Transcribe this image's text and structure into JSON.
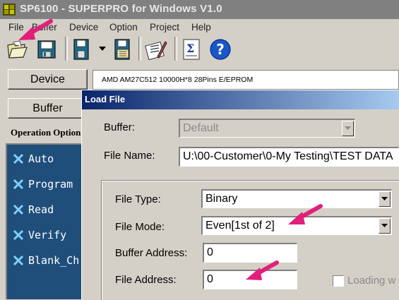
{
  "window": {
    "title": "SP6100 - SUPERPRO for Windows V1.0"
  },
  "menu": [
    "File",
    "Buffer",
    "Device",
    "Option",
    "Project",
    "Help"
  ],
  "toolbar": {
    "buttons": [
      "open-file-icon",
      "save-icon",
      "chip-load-icon",
      "chip-save-icon",
      "edit-tools-icon",
      "sum-icon",
      "help-icon"
    ]
  },
  "left": {
    "device_label": "Device",
    "buffer_label": "Buffer",
    "device_info": "AMD  AM27C512  10000H*8  28Pins  E/EPROM",
    "operation_option_label": "Operation Option",
    "operations": [
      "Auto",
      "Program",
      "Read",
      "Verify",
      "Blank_Ch"
    ]
  },
  "dialog": {
    "title": "Load File",
    "buffer_label": "Buffer:",
    "buffer_value": "Default",
    "file_name_label": "File Name:",
    "file_name_value": "U:\\00-Customer\\0-My Testing\\TEST DATA",
    "file_type_label": "File Type:",
    "file_type_value": "Binary",
    "file_mode_label": "File Mode:",
    "file_mode_value": "Even[1st of 2]",
    "buffer_address_label": "Buffer Address:",
    "buffer_address_value": "0",
    "file_address_label": "File Address:",
    "file_address_value": "0",
    "loading_label": "Loading w"
  },
  "colors": {
    "title_active": "#0a246a",
    "annotation_arrow": "#e0207a",
    "operation_panel": "#1f4e7a"
  }
}
